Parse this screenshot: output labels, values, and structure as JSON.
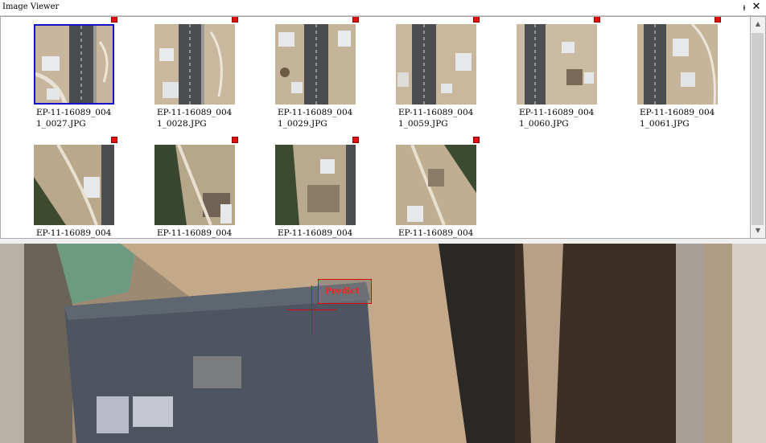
{
  "window": {
    "title": "Image Viewer",
    "pin_glyph": "ᵼ",
    "close_glyph": "✕"
  },
  "scrollbar": {
    "up": "▲",
    "down": "▼"
  },
  "thumbnails": [
    {
      "caption": "EP-11-16089_004\n1_0027.JPG",
      "selected": true
    },
    {
      "caption": "EP-11-16089_004\n1_0028.JPG",
      "selected": false
    },
    {
      "caption": "EP-11-16089_004\n1_0029.JPG",
      "selected": false
    },
    {
      "caption": "EP-11-16089_004\n1_0059.JPG",
      "selected": false
    },
    {
      "caption": "EP-11-16089_004\n1_0060.JPG",
      "selected": false
    },
    {
      "caption": "EP-11-16089_004\n1_0061.JPG",
      "selected": false
    },
    {
      "caption": "EP-11-16089_004",
      "selected": false
    },
    {
      "caption": "EP-11-16089_004",
      "selected": false
    },
    {
      "caption": "EP-11-16089_004",
      "selected": false
    },
    {
      "caption": "EP-11-16089_004",
      "selected": false
    }
  ],
  "viewer": {
    "predict_label": "Predict"
  },
  "colors": {
    "selection": "#1414c8",
    "marker": "#e01010",
    "predict": "#ff2020"
  }
}
